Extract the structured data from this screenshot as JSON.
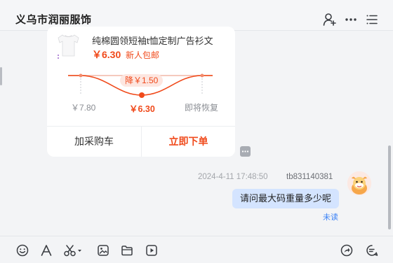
{
  "header": {
    "title": "义乌市润丽服饰",
    "icons": [
      "add-contact-icon",
      "more-icon",
      "menu-icon"
    ]
  },
  "product_card": {
    "title": "纯棉圆领短袖t恤定制广告衫文",
    "price": "￥6.30",
    "shipping": "新人包邮",
    "price_drop": "降￥1.50",
    "prices": {
      "before": "￥7.80",
      "current": "￥6.30",
      "after": "即将恢复"
    },
    "add_to_cart_label": "加采购车",
    "order_now_label": "立即下单",
    "accent_color": "#f04a1b"
  },
  "message": {
    "timestamp": "2024-4-11 17:48:50",
    "sender": "tb831140381",
    "text": "请问最大码重量多少呢",
    "status": "未读",
    "bubble_color": "#d4e4ff"
  },
  "toolbar": {
    "icons": [
      "emoji-icon",
      "font-icon",
      "screenshot-icon",
      "image-icon",
      "folder-icon",
      "video-icon",
      "share-icon",
      "quick-reply-icon"
    ]
  }
}
